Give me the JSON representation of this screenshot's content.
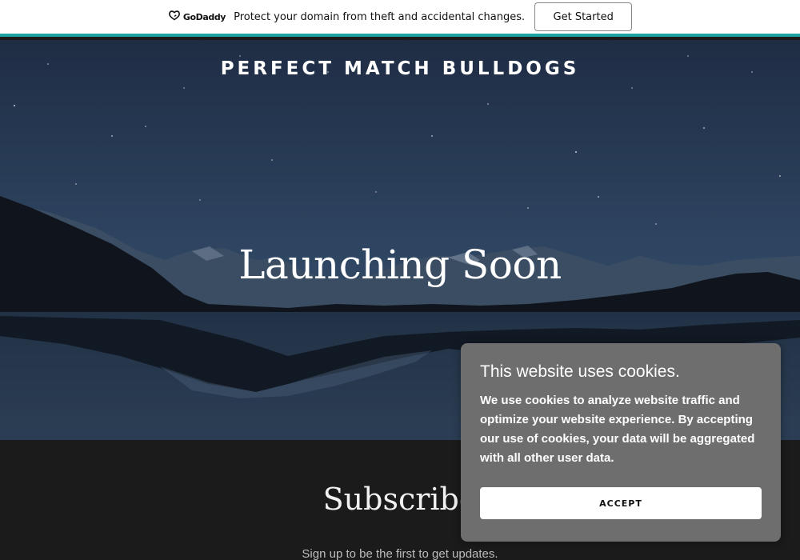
{
  "promo": {
    "logo_text": "GoDaddy",
    "message": "Protect your domain from theft and accidental changes.",
    "cta_label": "Get Started",
    "accent_color": "#1ba3a3"
  },
  "hero": {
    "site_title": "PERFECT MATCH BULLDOGS",
    "heading": "Launching Soon"
  },
  "subscribe": {
    "heading": "Subscribe",
    "text": "Sign up to be the first to get updates."
  },
  "cookie": {
    "title": "This website uses cookies.",
    "body": "We use cookies to analyze website traffic and optimize your website experience. By accepting our use of cookies, your data will be aggregated with all other user data.",
    "accept_label": "ACCEPT"
  },
  "icons": [
    "godaddy-logo-icon"
  ]
}
